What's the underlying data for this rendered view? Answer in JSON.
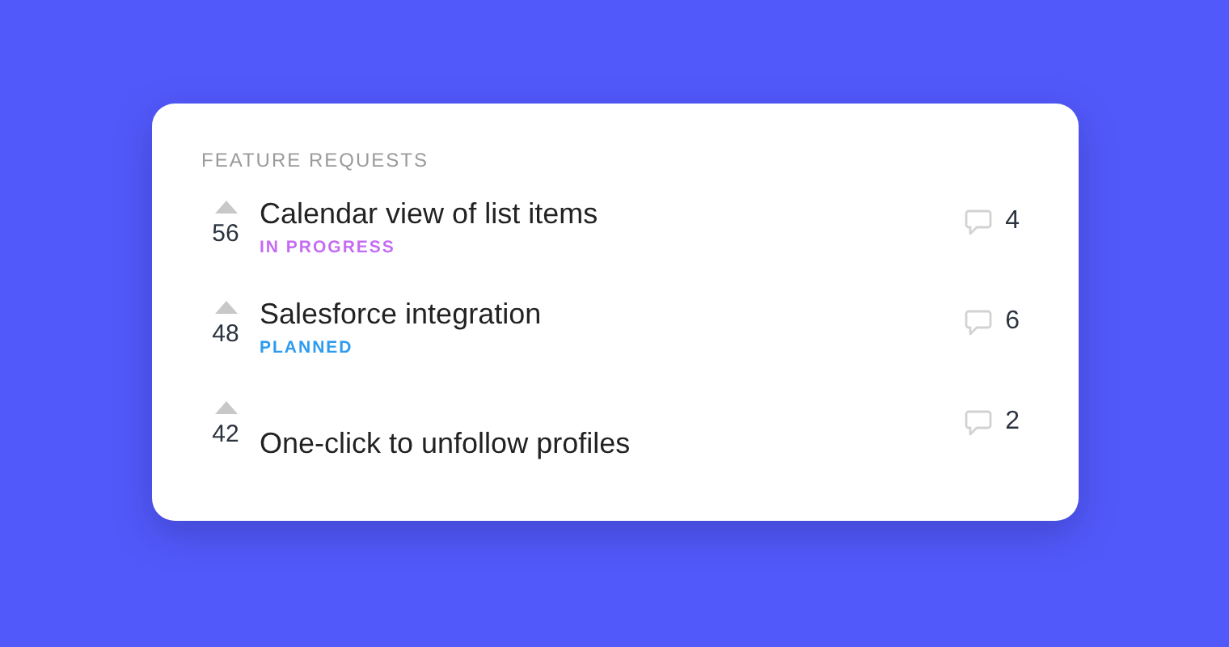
{
  "panel": {
    "title": "FEATURE REQUESTS"
  },
  "requests": [
    {
      "votes": "56",
      "title": "Calendar view of list items",
      "status": {
        "label": "IN PROGRESS",
        "color": "#c56df2"
      },
      "comments": "4"
    },
    {
      "votes": "48",
      "title": "Salesforce integration",
      "status": {
        "label": "PLANNED",
        "color": "#2d9cf0"
      },
      "comments": "6"
    },
    {
      "votes": "42",
      "title": "One-click to unfollow profiles",
      "comments": "2"
    }
  ]
}
